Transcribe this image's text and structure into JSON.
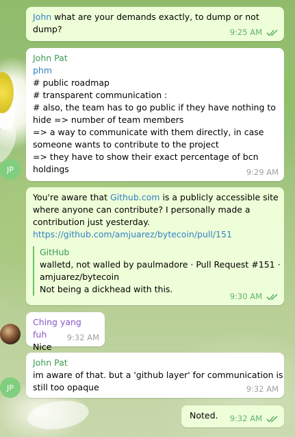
{
  "messages": {
    "m1": {
      "sender": "John",
      "text": " what are your demands exactly, to dump or not",
      "text2": "dump?",
      "time": "9:25 AM"
    },
    "m2": {
      "sender": "John Pat",
      "reply_to": "phm",
      "lines": [
        "# public roadmap",
        "# transparent communication :",
        "# also, the team has to go public if they have nothing to",
        "hide => number of team members",
        "=> a way to communicate with them directly, in case",
        "someone wants to contribute to the project",
        "=> they have to show their exact percentage of bcn",
        "holdings"
      ],
      "time": "9:29 AM",
      "avatar": "JP"
    },
    "m3": {
      "pre": "You're aware that ",
      "link_inline": "Github.com",
      "post": " is a publicly accessible site",
      "lines": [
        "where anyone can contribute? I personally made a",
        "contribution just yesterday."
      ],
      "url": "https://github.com/amjuarez/bytecoin/pull/151",
      "preview": {
        "site": "GitHub",
        "title1": "walletd, not walled by paulmadore · Pull Request #151 ·",
        "title2": "amjuarez/bytecoin",
        "desc": "Not being a dickhead with this."
      },
      "time": "9:30 AM"
    },
    "m4": {
      "sender": "Ching yang fuh",
      "text": "Nice",
      "time": "9:32 AM"
    },
    "m5": {
      "sender": "John Pat",
      "line1": "im aware of that. but a 'github layer' for communication is",
      "line2": "still too opaque",
      "time": "9:32 AM",
      "avatar": "JP"
    },
    "m6": {
      "text": "Noted.",
      "time": "9:32 AM"
    }
  }
}
